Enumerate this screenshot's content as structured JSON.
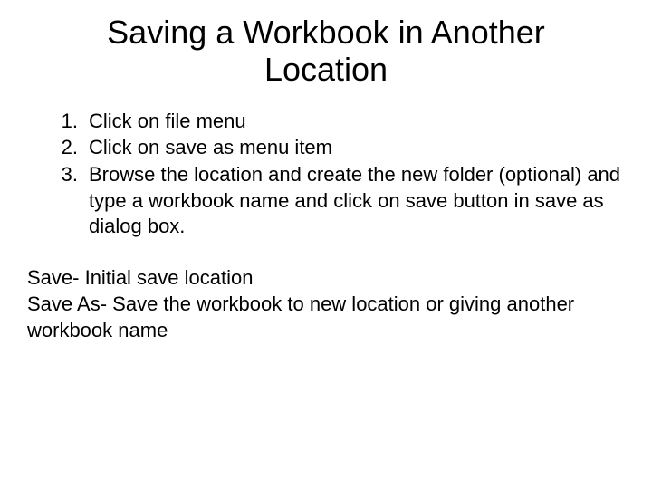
{
  "title": "Saving a Workbook in Another Location",
  "steps": [
    "Click on file menu",
    "Click on save as menu item",
    "Browse the location and create the new folder (optional) and type a workbook name and click on save button in save as dialog box."
  ],
  "notes": [
    "Save- Initial save location",
    "Save As- Save the workbook to new location or giving another workbook name"
  ]
}
